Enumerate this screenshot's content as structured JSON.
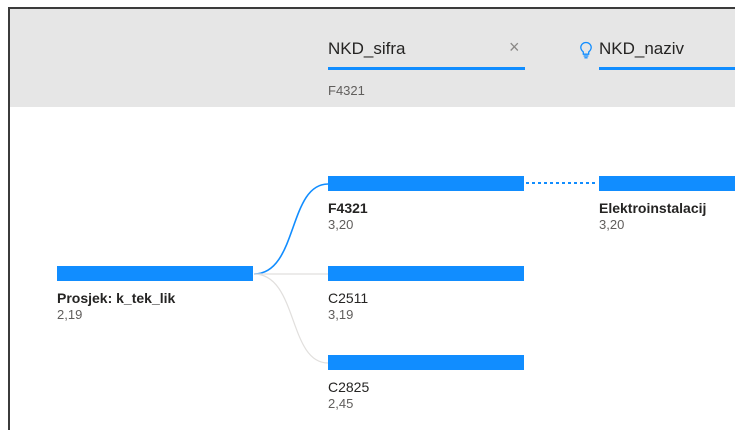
{
  "header": {
    "levels": [
      {
        "title": "NKD_sifra",
        "value": "F4321"
      },
      {
        "title": "NKD_naziv"
      }
    ],
    "icons": {
      "close": "close-icon",
      "bulb": "lightbulb-icon"
    }
  },
  "tree": {
    "root": {
      "label": "Prosjek: k_tek_lik",
      "value": "2,19"
    },
    "children": [
      {
        "label": "F4321",
        "value": "3,20"
      },
      {
        "label": "C2511",
        "value": "3,19"
      },
      {
        "label": "C2825",
        "value": "2,45"
      }
    ],
    "level2": [
      {
        "label": "Elektroinstalacij",
        "value": "3,20"
      }
    ]
  },
  "colors": {
    "accent": "#118dff",
    "header_bg": "#e6e6e6",
    "muted_text": "#605e5c"
  }
}
